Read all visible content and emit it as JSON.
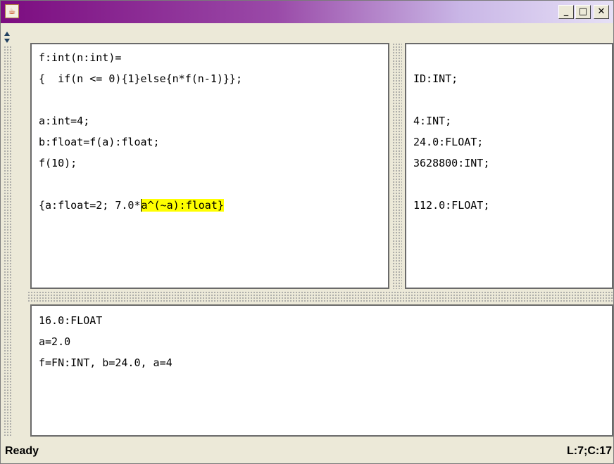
{
  "window": {
    "icon": "java-cup-icon",
    "controls": [
      "minimize",
      "maximize",
      "close"
    ]
  },
  "editor": {
    "lines": [
      "f:int(n:int)=",
      "{  if(n <= 0){1}else{n*f(n-1)}};",
      "",
      "a:int=4;",
      "b:float=f(a):float;",
      "f(10);",
      "",
      "{a:float=2; 7.0*"
    ],
    "highlight": "a^(~a):float}"
  },
  "results": {
    "lines": [
      "",
      "ID:INT;",
      "",
      "4:INT;",
      "24.0:FLOAT;",
      "3628800:INT;",
      "",
      "112.0:FLOAT;"
    ]
  },
  "console": {
    "lines": [
      "16.0:FLOAT",
      "a=2.0",
      "f=FN:INT, b=24.0, a=4"
    ]
  },
  "status": {
    "left": "Ready",
    "right": "L:7;C:17"
  }
}
